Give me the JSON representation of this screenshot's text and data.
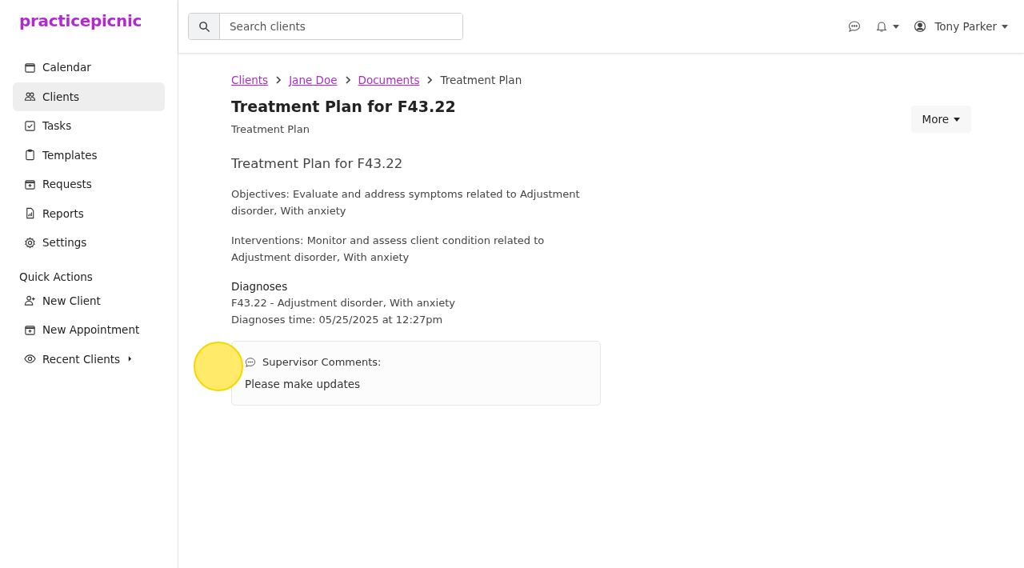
{
  "brand": "practicepicnic",
  "nav": [
    {
      "label": "Calendar",
      "selected": false
    },
    {
      "label": "Clients",
      "selected": true
    },
    {
      "label": "Tasks",
      "selected": false
    },
    {
      "label": "Templates",
      "selected": false
    },
    {
      "label": "Requests",
      "selected": false
    },
    {
      "label": "Reports",
      "selected": false
    },
    {
      "label": "Settings",
      "selected": false
    }
  ],
  "quick_actions": {
    "title": "Quick Actions",
    "items": [
      {
        "label": "New Client"
      },
      {
        "label": "New Appointment"
      },
      {
        "label": "Recent Clients",
        "kind": "submenu"
      }
    ]
  },
  "search": {
    "placeholder": "Search clients"
  },
  "user": {
    "name": "Tony Parker"
  },
  "breadcrumbs": [
    {
      "label": "Clients",
      "kind": "link"
    },
    {
      "label": "Jane Doe",
      "kind": "link"
    },
    {
      "label": "Documents",
      "kind": "link"
    },
    {
      "label": "Treatment Plan",
      "kind": "current"
    }
  ],
  "page": {
    "title": "Treatment Plan for F43.22",
    "subtitle": "Treatment Plan",
    "more_button": "More"
  },
  "document": {
    "heading": "Treatment Plan for F43.22",
    "paragraphs": [
      "Objectives: Evaluate and address symptoms related to Adjustment disorder, With anxiety",
      "Interventions: Monitor and assess client condition related to Adjustment disorder, With anxiety"
    ],
    "diagnoses": {
      "title": "Diagnoses",
      "lines": [
        "F43.22 - Adjustment disorder, With anxiety",
        "Diagnoses time: 05/25/2025 at 12:27pm"
      ]
    }
  },
  "comments": {
    "title": "Supervisor Comments:",
    "text": "Please make updates"
  }
}
